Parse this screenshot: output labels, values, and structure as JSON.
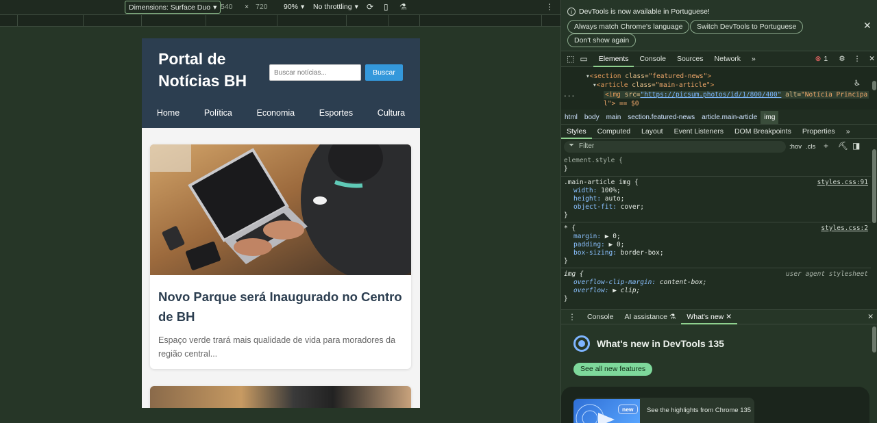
{
  "device_toolbar": {
    "dimensions_label": "Dimensions: Surface Duo",
    "width": "540",
    "times": "×",
    "height": "720",
    "zoom": "90%",
    "throttling": "No throttling"
  },
  "site": {
    "title": "Portal de Notícias BH",
    "search_placeholder": "Buscar notícias...",
    "search_button": "Buscar",
    "nav": [
      "Home",
      "Política",
      "Economia",
      "Esportes",
      "Cultura"
    ],
    "articles": [
      {
        "title": "Novo Parque será Inaugurado no Centro de BH",
        "excerpt": "Espaço verde trará mais qualidade de vida para moradores da região central..."
      }
    ]
  },
  "devtools": {
    "infobar": {
      "message": "DevTools is now available in Portuguese!",
      "always_match": "Always match Chrome's language",
      "switch": "Switch DevTools to Portuguese",
      "dont_show": "Don't show again"
    },
    "main_tabs": [
      "Elements",
      "Console",
      "Sources",
      "Network"
    ],
    "error_count": "1",
    "dom": {
      "line1_tag": "<section",
      "line1_attr": "class=",
      "line1_val": "\"featured-news\"",
      "line1_end": ">",
      "line2_tag": "<article",
      "line2_attr": "class=",
      "line2_val": "\"main-article\"",
      "line2_end": ">",
      "line3_tag": "<img",
      "line3_attr1": "src=",
      "line3_url": "\"https://picsum.photos/id/1/800/400\"",
      "line3_attr2": "alt=",
      "line3_val": "\"Notícia Principa",
      "line3_cont": "l\"> == $0",
      "ellipsis": "..."
    },
    "breadcrumbs": [
      "html",
      "body",
      "main",
      "section.featured-news",
      "article.main-article",
      "img"
    ],
    "sub_tabs": [
      "Styles",
      "Computed",
      "Layout",
      "Event Listeners",
      "DOM Breakpoints",
      "Properties"
    ],
    "filter_placeholder": "Filter",
    "hov": ":hov",
    "cls": ".cls",
    "styles": {
      "element_style": "element.style {",
      "close": "}",
      "rule1_selector": ".main-article img {",
      "rule1_source": "styles.css:91",
      "rule1_props": [
        [
          "width",
          "100%;"
        ],
        [
          "height",
          "auto;"
        ],
        [
          "object-fit",
          "cover;"
        ]
      ],
      "rule2_selector": "* {",
      "rule2_source": "styles.css:2",
      "rule2_props": [
        [
          "margin",
          "▶ 0;"
        ],
        [
          "padding",
          "▶ 0;"
        ],
        [
          "box-sizing",
          "border-box;"
        ]
      ],
      "rule3_selector": "img {",
      "rule3_source": "user agent stylesheet",
      "rule3_props": [
        [
          "overflow-clip-margin",
          "content-box;"
        ],
        [
          "overflow",
          "▶ clip;"
        ]
      ]
    },
    "drawer": {
      "tabs": [
        "Console",
        "AI assistance",
        "What's new"
      ],
      "whats_new_title": "What's new in DevTools 135",
      "see_all": "See all new features",
      "badge": "new",
      "highlights": "See the highlights from Chrome 135"
    }
  }
}
